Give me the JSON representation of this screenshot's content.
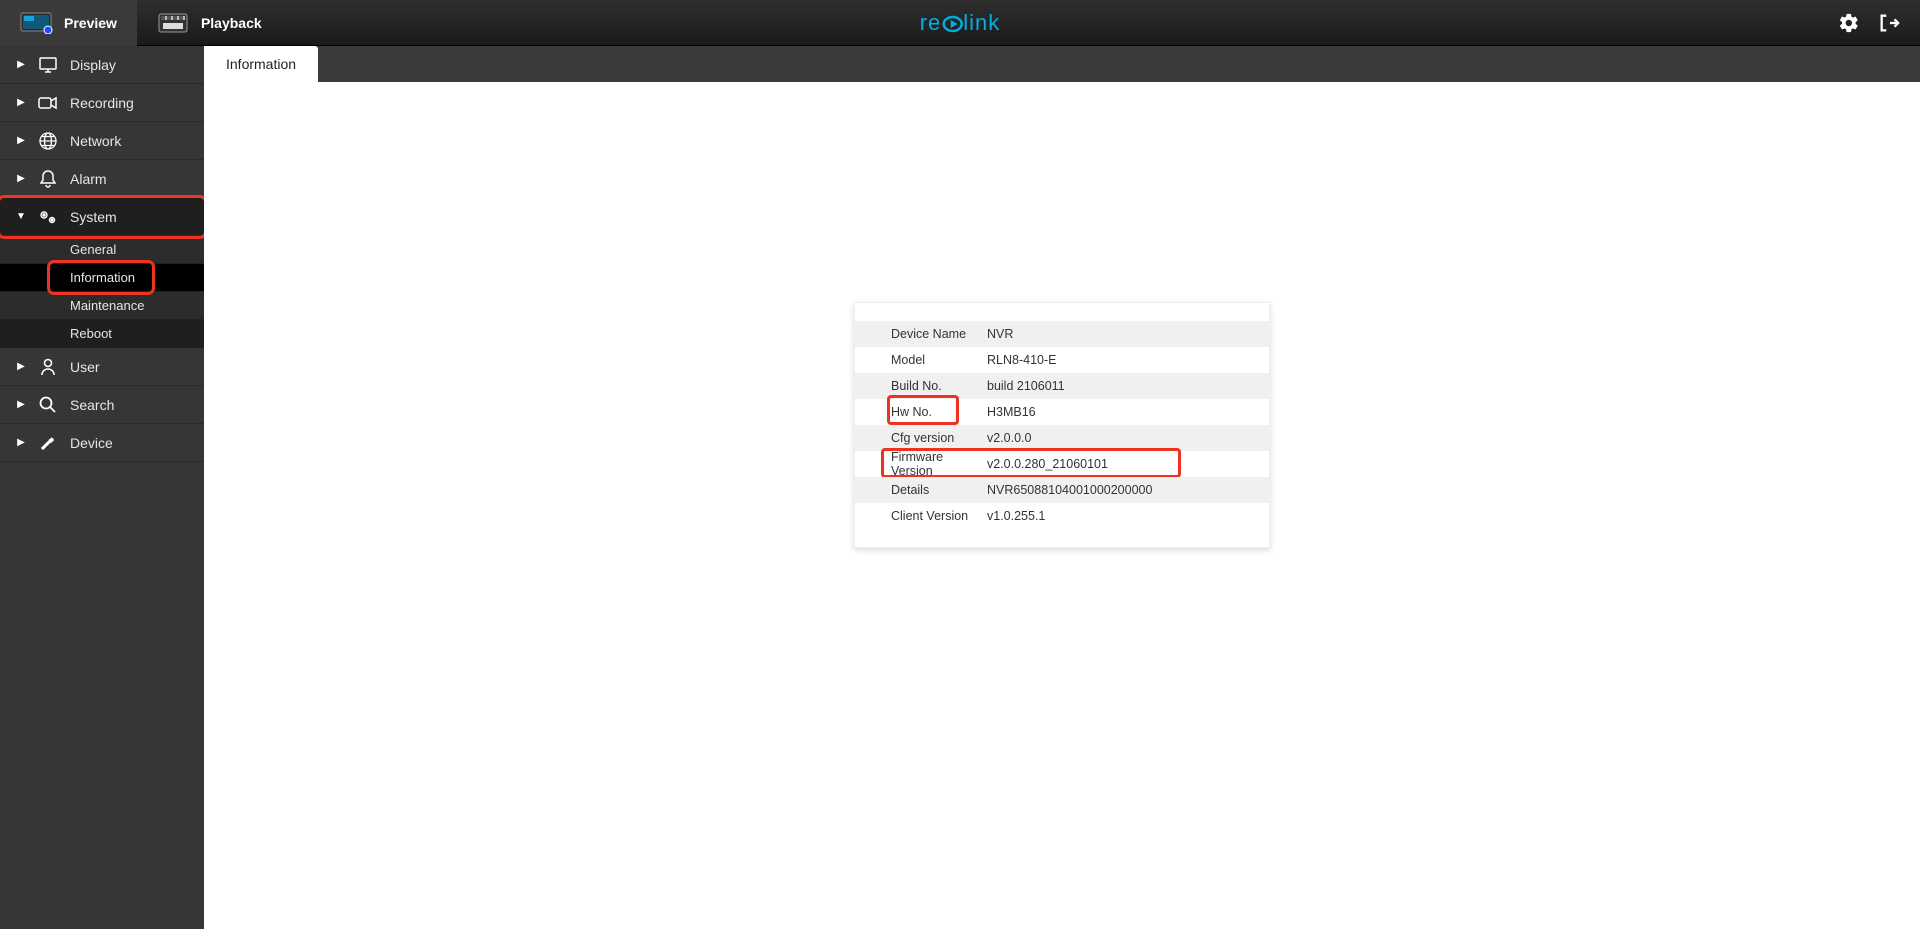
{
  "topbar": {
    "preview_label": "Preview",
    "playback_label": "Playback",
    "brand_a": "re",
    "brand_b": "link"
  },
  "tabs": {
    "active": "Information"
  },
  "sidebar": {
    "display": "Display",
    "recording": "Recording",
    "network": "Network",
    "alarm": "Alarm",
    "system": "System",
    "system_sub": {
      "general": "General",
      "information": "Information",
      "maintenance": "Maintenance",
      "reboot": "Reboot"
    },
    "user": "User",
    "search": "Search",
    "device": "Device"
  },
  "info": {
    "rows": [
      {
        "label": "Device Name",
        "value": "NVR"
      },
      {
        "label": "Model",
        "value": "RLN8-410-E"
      },
      {
        "label": "Build No.",
        "value": "build 2106011"
      },
      {
        "label": "Hw No.",
        "value": "H3MB16"
      },
      {
        "label": "Cfg version",
        "value": "v2.0.0.0"
      },
      {
        "label": "Firmware Version",
        "value": "v2.0.0.280_21060101"
      },
      {
        "label": "Details",
        "value": "NVR65088104001000200000"
      },
      {
        "label": "Client Version",
        "value": "v1.0.255.1"
      }
    ]
  }
}
